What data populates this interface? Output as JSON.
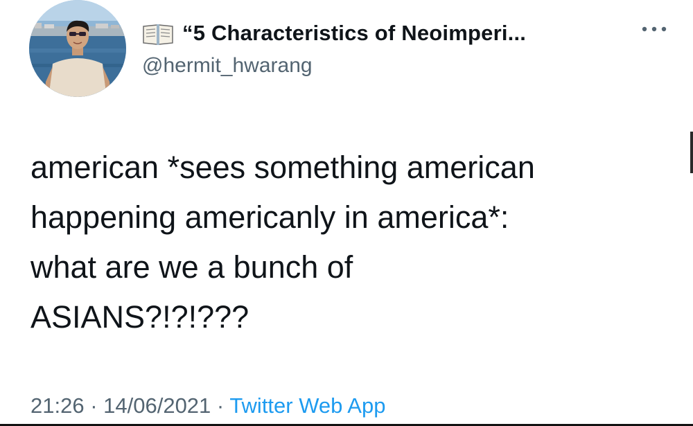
{
  "tweet": {
    "display_name": "“5 Characteristics of Neoimperi...",
    "handle": "@hermit_hwarang",
    "text_lines": [
      "american *sees something american",
      "happening americanly in america*:",
      "what are we a bunch of",
      "ASIANS?!?!???"
    ],
    "time": "21:26",
    "separator": "·",
    "date": "14/06/2021",
    "source": "Twitter Web App"
  },
  "icons": {
    "name_prefix": "open-book-icon",
    "more": "more-horizontal-icon"
  },
  "colors": {
    "text": "#0f1419",
    "secondary": "#536471",
    "link": "#1d9bf0"
  }
}
